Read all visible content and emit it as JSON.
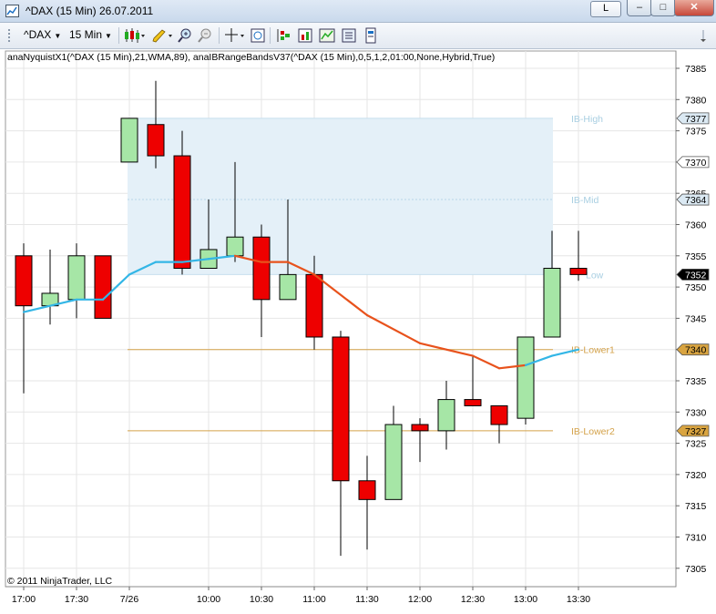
{
  "window": {
    "title": "^DAX (15 Min)  26.07.2011",
    "l_button": "L",
    "min_label": "–",
    "max_label": "□",
    "close_label": "✕"
  },
  "toolbar": {
    "instrument": "^DAX",
    "interval": "15 Min"
  },
  "indicator_label": "anaNyquistX1(^DAX (15 Min),21,WMA,89), anaIBRangeBandsV37(^DAX (15 Min),0,5,1,2,01:00,None,Hybrid,True)",
  "copyright": "© 2011 NinjaTrader, LLC",
  "chart_data": {
    "type": "candlestick",
    "ylim": [
      7301,
      7388
    ],
    "y_ticks": [
      7305,
      7310,
      7315,
      7320,
      7325,
      7330,
      7335,
      7340,
      7345,
      7350,
      7355,
      7360,
      7365,
      7370,
      7375,
      7380,
      7385
    ],
    "x_ticks": [
      {
        "i": 0,
        "label": "17:00"
      },
      {
        "i": 2,
        "label": "17:30"
      },
      {
        "i": 4,
        "label": "7/26"
      },
      {
        "i": 7,
        "label": "10:00"
      },
      {
        "i": 9,
        "label": "10:30"
      },
      {
        "i": 11,
        "label": "11:00"
      },
      {
        "i": 13,
        "label": "11:30"
      },
      {
        "i": 15,
        "label": "12:00"
      },
      {
        "i": 17,
        "label": "12:30"
      },
      {
        "i": 19,
        "label": "13:00"
      },
      {
        "i": 21,
        "label": "13:30"
      }
    ],
    "candles": [
      {
        "o": 7355,
        "h": 7357,
        "l": 7333,
        "c": 7347
      },
      {
        "o": 7347,
        "h": 7356,
        "l": 7344,
        "c": 7349
      },
      {
        "o": 7348,
        "h": 7357,
        "l": 7345,
        "c": 7355
      },
      {
        "o": 7355,
        "h": 7355,
        "l": 7345,
        "c": 7345
      },
      {
        "o": 7370,
        "h": 7377,
        "l": 7370,
        "c": 7377
      },
      {
        "o": 7376,
        "h": 7383,
        "l": 7369,
        "c": 7371
      },
      {
        "o": 7371,
        "h": 7375,
        "l": 7352,
        "c": 7353
      },
      {
        "o": 7353,
        "h": 7364,
        "l": 7353,
        "c": 7356
      },
      {
        "o": 7355,
        "h": 7370,
        "l": 7354,
        "c": 7358
      },
      {
        "o": 7358,
        "h": 7360,
        "l": 7342,
        "c": 7348
      },
      {
        "o": 7348,
        "h": 7364,
        "l": 7348,
        "c": 7352
      },
      {
        "o": 7352,
        "h": 7355,
        "l": 7340,
        "c": 7342
      },
      {
        "o": 7342,
        "h": 7343,
        "l": 7307,
        "c": 7319
      },
      {
        "o": 7319,
        "h": 7323,
        "l": 7308,
        "c": 7316
      },
      {
        "o": 7316,
        "h": 7331,
        "l": 7316,
        "c": 7328
      },
      {
        "o": 7328,
        "h": 7329,
        "l": 7322,
        "c": 7327
      },
      {
        "o": 7327,
        "h": 7335,
        "l": 7324,
        "c": 7332
      },
      {
        "o": 7332,
        "h": 7339,
        "l": 7331,
        "c": 7331
      },
      {
        "o": 7331,
        "h": 7331,
        "l": 7325,
        "c": 7328
      },
      {
        "o": 7329,
        "h": 7342,
        "l": 7328,
        "c": 7342
      },
      {
        "o": 7342,
        "h": 7359,
        "l": 7342,
        "c": 7353
      },
      {
        "o": 7353,
        "h": 7359,
        "l": 7351,
        "c": 7352
      }
    ],
    "ib_band": {
      "high": 7377,
      "mid": 7364,
      "low": 7352,
      "start_i": 4,
      "end_i": 20
    },
    "ib_lines": [
      {
        "value": 7340,
        "label": "IB-Lower1"
      },
      {
        "value": 7327,
        "label": "IB-Lower2"
      }
    ],
    "ib_labels": {
      "high": "IB-High",
      "mid": "IB-Mid",
      "low": "Low"
    },
    "nyquist": [
      {
        "i": 0,
        "v": 7346
      },
      {
        "i": 1,
        "v": 7347
      },
      {
        "i": 2,
        "v": 7348
      },
      {
        "i": 3,
        "v": 7348
      },
      {
        "i": 4,
        "v": 7352
      },
      {
        "i": 5,
        "v": 7354
      },
      {
        "i": 6,
        "v": 7354
      },
      {
        "i": 7,
        "v": 7354.5
      },
      {
        "i": 8,
        "v": 7355
      },
      {
        "i": 9,
        "v": 7354
      },
      {
        "i": 10,
        "v": 7354
      },
      {
        "i": 11,
        "v": 7352
      },
      {
        "i": 13,
        "v": 7345.5
      },
      {
        "i": 15,
        "v": 7341
      },
      {
        "i": 17,
        "v": 7339
      },
      {
        "i": 18,
        "v": 7337
      },
      {
        "i": 19,
        "v": 7337.5
      },
      {
        "i": 20,
        "v": 7339
      },
      {
        "i": 21,
        "v": 7340
      }
    ],
    "nyquist_colors": [
      "#33b6e6",
      "#33b6e6",
      "#33b6e6",
      "#33b6e6",
      "#33b6e6",
      "#33b6e6",
      "#33b6e6",
      "#33b6e6",
      "#e8521c",
      "#e8521c",
      "#e8521c",
      "#e8521c",
      "#e8521c",
      "#e8521c",
      "#e8521c",
      "#e8521c",
      "#33b6e6",
      "#33b6e6"
    ],
    "price_markers": [
      {
        "value": 7377,
        "label": "7377",
        "bg": "#dbe9f3",
        "fg": "#000000"
      },
      {
        "value": 7370,
        "label": "7370",
        "bg": "#ffffff",
        "fg": "#000000"
      },
      {
        "value": 7364,
        "label": "7364",
        "bg": "#dbe9f3",
        "fg": "#000000"
      },
      {
        "value": 7352,
        "label": "7352",
        "bg": "#000000",
        "fg": "#ffffff"
      },
      {
        "value": 7340,
        "label": "7340",
        "bg": "#d9a440",
        "fg": "#000000"
      },
      {
        "value": 7327,
        "label": "7327",
        "bg": "#d9a440",
        "fg": "#000000"
      }
    ],
    "colors": {
      "up": "#a6e6a6",
      "down": "#ee0000",
      "band": "#e4f0f8",
      "ib_text": "#a9cfe2",
      "ib_line": "#d4a24a",
      "grid": "#e6e6e6"
    }
  }
}
